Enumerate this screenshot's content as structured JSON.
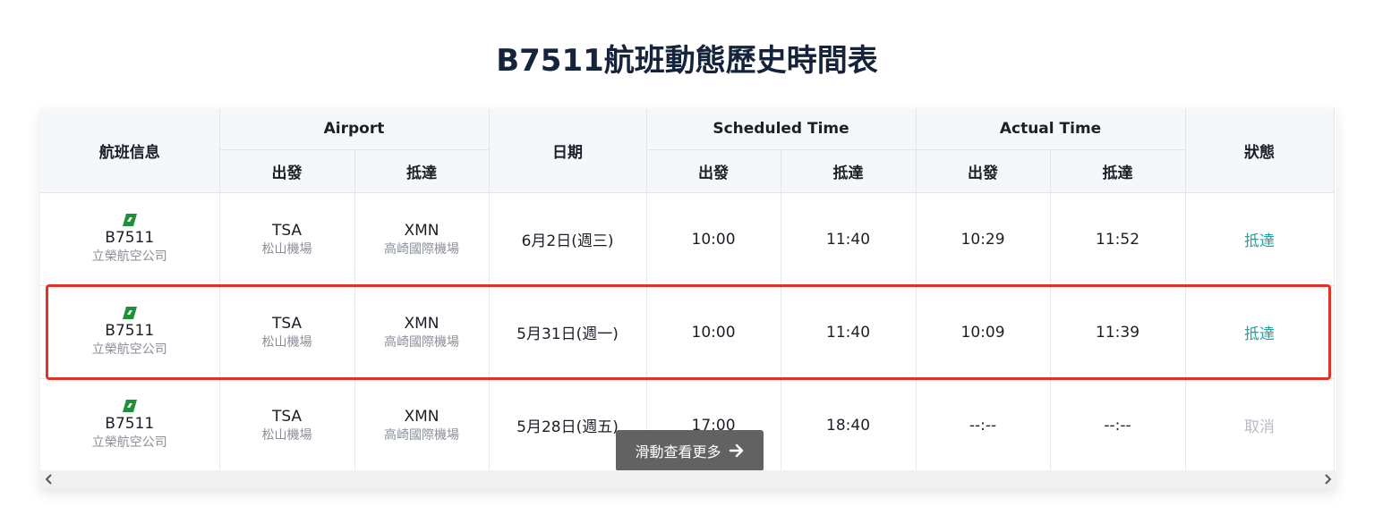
{
  "page": {
    "title": "B7511航班動態歷史時間表"
  },
  "table": {
    "headers": {
      "flight_info": "航班信息",
      "airport": "Airport",
      "date": "日期",
      "scheduled": "Scheduled Time",
      "actual": "Actual Time",
      "status": "狀態",
      "depart": "出發",
      "arrive": "抵達"
    },
    "rows": [
      {
        "flight": "B7511",
        "airline": "立榮航空公司",
        "from_code": "TSA",
        "from_name": "松山機場",
        "to_code": "XMN",
        "to_name": "高崎國際機場",
        "date": "6月2日(週三)",
        "sched_dep": "10:00",
        "sched_arr": "11:40",
        "act_dep": "10:29",
        "act_arr": "11:52",
        "status": "抵達"
      },
      {
        "flight": "B7511",
        "airline": "立榮航空公司",
        "from_code": "TSA",
        "from_name": "松山機場",
        "to_code": "XMN",
        "to_name": "高崎國際機場",
        "date": "5月31日(週一)",
        "sched_dep": "10:00",
        "sched_arr": "11:40",
        "act_dep": "10:09",
        "act_arr": "11:39",
        "status": "抵達"
      },
      {
        "flight": "B7511",
        "airline": "立榮航空公司",
        "from_code": "TSA",
        "from_name": "松山機場",
        "to_code": "XMN",
        "to_name": "高崎國際機場",
        "date": "5月28日(週五)",
        "sched_dep": "17:00",
        "sched_arr": "18:40",
        "act_dep": "--:--",
        "act_arr": "--:--",
        "status": "取消"
      }
    ]
  },
  "scroll_hint": {
    "label": "滑動查看更多"
  },
  "colors": {
    "status_arrived": "#1ba5a2",
    "status_cancelled": "#b7bcc4",
    "highlight": "#e23228",
    "title": "#16243b"
  },
  "icons": {
    "airline_logo": "uni-air-logo-icon",
    "scroll_hint": "arrow-right-icon",
    "scroll_left": "chevron-left-icon",
    "scroll_right": "chevron-right-icon"
  }
}
